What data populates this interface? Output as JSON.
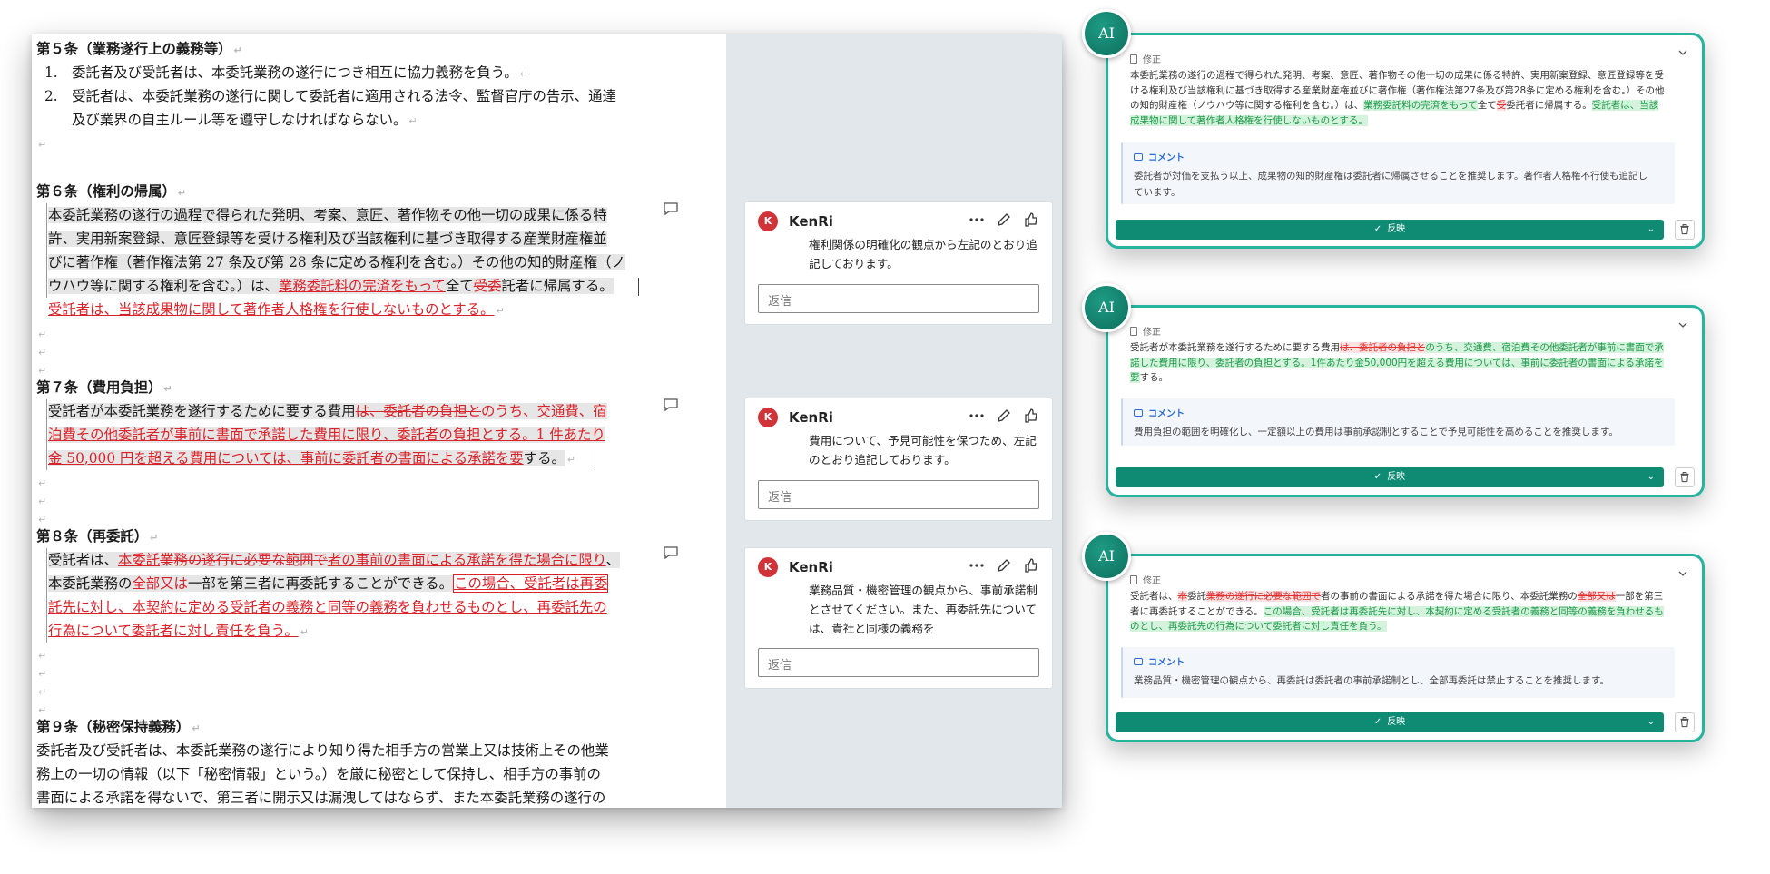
{
  "document": {
    "art5_heading": "第５条（業務遂行上の義務等）",
    "art5_1": "1.　委託者及び受託者は、本委託業務の遂行につき相互に協力義務を負う。",
    "art5_2a": "2.　受託者は、本委託業務の遂行に関して委託者に適用される法令、監督官庁の告示、通達",
    "art5_2b": "及び業界の自主ルール等を遵守しなければならない。",
    "art6_heading": "第６条（権利の帰属）",
    "art6_l1": "本委託業務の遂行の過程で得られた発明、考案、意匠、著作物その他一切の成果に係る特",
    "art6_l2": "許、実用新案登録、意匠登録等を受ける権利及び当該権利に基づき取得する産業財産権並",
    "art6_l3": "びに著作権（著作権法第 27 条及び第 28 条に定める権利を含む。）その他の知的財産権（ノ",
    "art6_l4_a": "ウハウ等に関する権利を含む。）は、",
    "art6_l4_ins": "業務委託料の完済をもって",
    "art6_l4_b": "全て",
    "art6_l4_del": "受委",
    "art6_l4_c": "託者に帰属する。",
    "art6_l5_ins": "受託者は、当該成果物に関して著作者人格権を行使しないものとする。",
    "art7_heading": "第７条（費用負担）",
    "art7_l1_a": "受託者が本委託業務を遂行するために要する費用",
    "art7_l1_del": "は、委託者の負担と",
    "art7_l1_ins": "のうち、交通費、宿",
    "art7_l2_ins": "泊費その他委託者が事前に書面で承諾した費用に限り、委託者の負担とする。1 件あたり",
    "art7_l3_ins": "金 50,000 円を超える費用については、事前に委託者の書面による承諾を要",
    "art7_l3_b": "する。",
    "art8_heading": "第８条（再委託）",
    "art8_l1_a": "受託者は、",
    "art8_l1_ins1": "本委託",
    "art8_l1_del": "業務の遂行に必要な範囲で",
    "art8_l1_ins2": "者の事前の書面による承諾を得た場合に限り",
    "art8_l1_b": "、",
    "art8_l2_a": "本委託業務の",
    "art8_l2_del": "全部又は",
    "art8_l2_b": "一部を第三者に再委託することができる。",
    "art8_l2_ins": "この場合、受託者は再委",
    "art8_l3_ins": "託先に対し、本契約に定める受託者の義務と同等の義務を負わせるものとし、再委託先の",
    "art8_l4_ins": "行為について委託者に対し責任を負う。",
    "art9_heading": "第９条（秘密保持義務）",
    "art9_l1": "委託者及び受託者は、本委託業務の遂行により知り得た相手方の営業上又は技術上その他業",
    "art9_l2": "務上の一切の情報（以下「秘密情報」という。）を厳に秘密として保持し、相手方の事前の",
    "art9_l3": "書面による承諾を得ないで、第三者に開示又は漏洩してはならず、また本委託業務の遂行の",
    "para_mark": "↵"
  },
  "comments": [
    {
      "avatar": "K",
      "author": "KenRi",
      "text": "権利関係の明確化の観点から左記のとおり追記しております。",
      "reply_placeholder": "返信"
    },
    {
      "avatar": "K",
      "author": "KenRi",
      "text": "費用について、予見可能性を保つため、左記のとおり追記しております。",
      "reply_placeholder": "返信"
    },
    {
      "avatar": "K",
      "author": "KenRi",
      "text": "業務品質・機密管理の観点から、事前承諾制とさせてください。また、再委託先については、貴社と同様の義務を",
      "reply_placeholder": "返信"
    }
  ],
  "ai_cards": [
    {
      "badge": "AI",
      "section": "修正",
      "body_a": "本委託業務の遂行の過程で得られた発明、考案、意匠、著作物その他一切の成果に係る特許、実用新案登録、意匠登録等を受ける権利及び当該権利に基づき取得する産業財産権並びに著作権（著作権法第27条及び第28条に定める権利を含む。）その他の知的財産権（ノウハウ等に関する権利を含む。）は、",
      "body_g1": "業務委託料の完済をもって",
      "body_b": "全て",
      "body_r": "受",
      "body_c": "委託者に帰属する。",
      "body_g2": "受託者は、当該成果物に関して著作者人格権を行使しないものとする。",
      "comment_label": "コメント",
      "comment": "委託者が対価を支払う以上、成果物の知的財産権は委託者に帰属させることを推奨します。著作者人格権不行使も追記しています。",
      "apply": "反映"
    },
    {
      "badge": "AI",
      "section": "修正",
      "body_a": "受託者が本委託業務を遂行するために要する費用",
      "body_r": "は、委託者の負担と",
      "body_g1": "のうち、交通費、宿泊費その他委託者が事前に書面で承諾した費用に限り、委託者の負担とする。1件あたり金50,000円を超える費用については、事前に委託者の書面による承諾を要",
      "body_b": "する。",
      "comment_label": "コメント",
      "comment": "費用負担の範囲を明確化し、一定額以上の費用は事前承認制とすることで予見可能性を高めることを推奨します。",
      "apply": "反映"
    },
    {
      "badge": "AI",
      "section": "修正",
      "body_a": "受託者は、",
      "body_r1": "本",
      "body_b": "委託",
      "body_r2": "業務の遂行に必要な範囲で",
      "body_c": "者の事前の書面による承諾を得た場合に限り、本委託業務の",
      "body_r3": "全部又は",
      "body_d": "一部を第三者に再委託することができる。",
      "body_g1": "この場合、受託者は再委託先に対し、本契約に定める受託者の義務と同等の義務を負わせるものとし、再委託先の行為について委託者に対し責任を負う。",
      "comment_label": "コメント",
      "comment": "業務品質・機密管理の観点から、再委託は委託者の事前承諾制とし、全部再委託は禁止することを推奨します。",
      "apply": "反映"
    }
  ],
  "colors": {
    "accent": "#0f8b74",
    "ai_border": "#26b3a0",
    "track_change": "#d8232a",
    "avatar": "#d13438"
  }
}
